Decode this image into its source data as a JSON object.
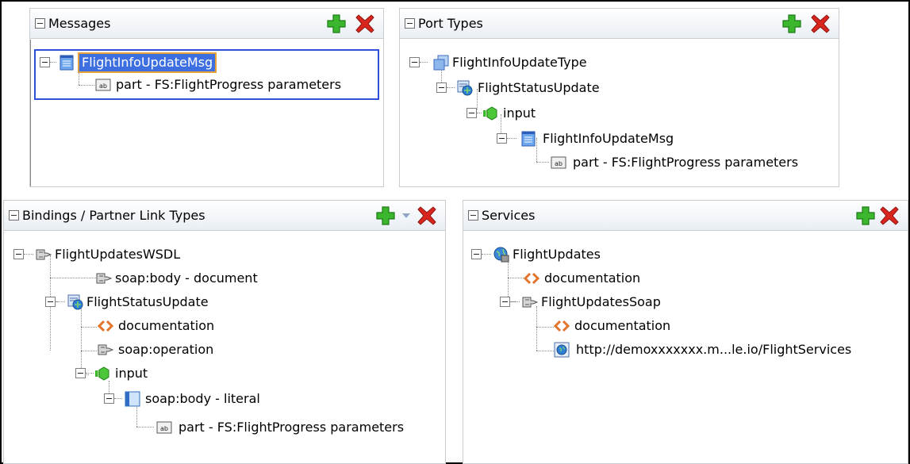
{
  "messages": {
    "title": "Messages",
    "add_label": "",
    "delete_label": "",
    "items": [
      {
        "label": "FlightInfoUpdateMsg",
        "icon": "message-icon"
      },
      {
        "label": "part - FS:FlightProgress parameters",
        "icon": "part-ab-icon"
      }
    ]
  },
  "port_types": {
    "title": "Port Types",
    "items": [
      {
        "label": "FlightInfoUpdateType",
        "icon": "port-type-icon"
      },
      {
        "label": "FlightStatusUpdate",
        "icon": "operation-icon"
      },
      {
        "label": "input",
        "icon": "input-icon"
      },
      {
        "label": "FlightInfoUpdateMsg",
        "icon": "message-icon"
      },
      {
        "label": "part - FS:FlightProgress parameters",
        "icon": "part-ab-icon"
      }
    ]
  },
  "bindings": {
    "title": "Bindings / Partner Link Types",
    "items": [
      {
        "label": "FlightUpdatesWSDL",
        "icon": "binding-icon"
      },
      {
        "label": "soap:body - document",
        "icon": "binding-icon"
      },
      {
        "label": "FlightStatusUpdate",
        "icon": "operation-icon"
      },
      {
        "label": "documentation",
        "icon": "documentation-icon"
      },
      {
        "label": "soap:operation",
        "icon": "binding-icon"
      },
      {
        "label": "input",
        "icon": "input-icon"
      },
      {
        "label": "soap:body - literal",
        "icon": "soap-body-icon"
      },
      {
        "label": "part - FS:FlightProgress parameters",
        "icon": "part-ab-icon"
      }
    ]
  },
  "services": {
    "title": "Services",
    "items": [
      {
        "label": "FlightUpdates",
        "icon": "service-icon"
      },
      {
        "label": "documentation",
        "icon": "documentation-icon"
      },
      {
        "label": "FlightUpdatesSoap",
        "icon": "binding-icon"
      },
      {
        "label": "documentation",
        "icon": "documentation-icon"
      },
      {
        "label": "http://demoxxxxxxx.m...le.io/FlightServices",
        "icon": "globe-icon"
      }
    ]
  },
  "colors": {
    "accent_add": "#3cb62c",
    "accent_delete": "#d8261e",
    "selection": "#3e6fe0",
    "selection_border": "#3050d8",
    "selection_outline": "#e8a23a"
  }
}
